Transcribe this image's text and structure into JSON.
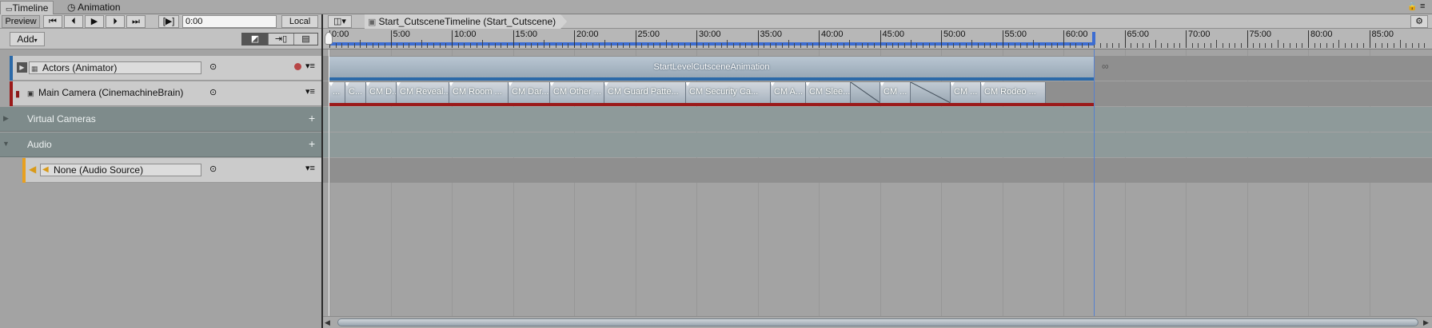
{
  "tabs": [
    {
      "label": "Timeline",
      "icon": "timeline-icon",
      "active": true
    },
    {
      "label": "Animation",
      "icon": "clock-icon",
      "active": false
    }
  ],
  "toolbar": {
    "preview_label": "Preview",
    "time_value": "0:00",
    "local_label": "Local",
    "play_range_label": "[▶]"
  },
  "breadcrumb": {
    "label": "Start_CutsceneTimeline (Start_Cutscene)"
  },
  "add_label": "Add",
  "tracks": {
    "actors": {
      "name": "Actors (Animator)",
      "clip": "StartLevelCutsceneAnimation"
    },
    "camera": {
      "name": "Main Camera (CinemachineBrain)"
    },
    "virtual_cameras": {
      "name": "Virtual Cameras",
      "add": "+"
    },
    "audio_group": {
      "name": "Audio",
      "add": "+"
    },
    "audio_source": {
      "name": "None (Audio Source)"
    }
  },
  "ruler_labels": [
    "0:00",
    "5:00",
    "10:00",
    "15:00",
    "20:00",
    "25:00",
    "30:00",
    "35:00",
    "40:00",
    "45:00",
    "50:00",
    "55:00",
    "60:00",
    "65:00",
    "70:00",
    "75:00",
    "80:00",
    "85:00"
  ],
  "camera_clips": [
    "...",
    "C...",
    "CM D...",
    "CM Reveal...",
    "CM Room ...",
    "CM Dar...",
    "CM Other ...",
    "CM Guard Patte...",
    "CM Security Ca...",
    "CM A...",
    "CM Slee...",
    "",
    "CM ...",
    "",
    "CM ...",
    "CM Rodeo ..."
  ],
  "colors": {
    "actors_accent": "#2b69a8",
    "camera_accent": "#9b1a1a",
    "audio_accent": "#e8a020",
    "playhead_range": "#3d6dd1"
  }
}
